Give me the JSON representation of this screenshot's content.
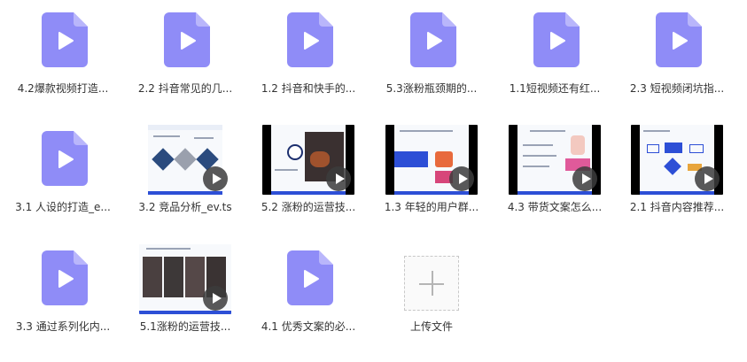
{
  "colors": {
    "file_icon": "#8f8cf7",
    "file_icon_fold": "#b9b6fb",
    "play": "#ffffff",
    "thumb_accent": "#2d4fd6"
  },
  "files": [
    {
      "type": "file",
      "icon": "video-file-icon",
      "label": "4.2爆款视频打造..."
    },
    {
      "type": "file",
      "icon": "video-file-icon",
      "label": "2.2 抖音常见的几..."
    },
    {
      "type": "file",
      "icon": "video-file-icon",
      "label": "1.2 抖音和快手的..."
    },
    {
      "type": "file",
      "icon": "video-file-icon",
      "label": "5.3涨粉瓶颈期的..."
    },
    {
      "type": "file",
      "icon": "video-file-icon",
      "label": "1.1短视频还有红..."
    },
    {
      "type": "file",
      "icon": "video-file-icon",
      "label": "2.3 短视频闭坑指..."
    },
    {
      "type": "file",
      "icon": "video-file-icon",
      "label": "3.1 人设的打造_e..."
    },
    {
      "type": "thumb",
      "icon": "video-thumbnail",
      "label": "3.2 竞品分析_ev.ts"
    },
    {
      "type": "thumb",
      "icon": "video-thumbnail",
      "label": "5.2 涨粉的运营技..."
    },
    {
      "type": "thumb",
      "icon": "video-thumbnail",
      "label": "1.3 年轻的用户群..."
    },
    {
      "type": "thumb",
      "icon": "video-thumbnail",
      "label": "4.3 带货文案怎么..."
    },
    {
      "type": "thumb",
      "icon": "video-thumbnail",
      "label": "2.1 抖音内容推荐..."
    },
    {
      "type": "file",
      "icon": "video-file-icon",
      "label": "3.3 通过系列化内..."
    },
    {
      "type": "thumb",
      "icon": "video-thumbnail",
      "label": "5.1涨粉的运营技..."
    },
    {
      "type": "file",
      "icon": "video-file-icon",
      "label": "4.1 优秀文案的必..."
    },
    {
      "type": "upload",
      "icon": "plus-icon",
      "label": "上传文件"
    }
  ]
}
